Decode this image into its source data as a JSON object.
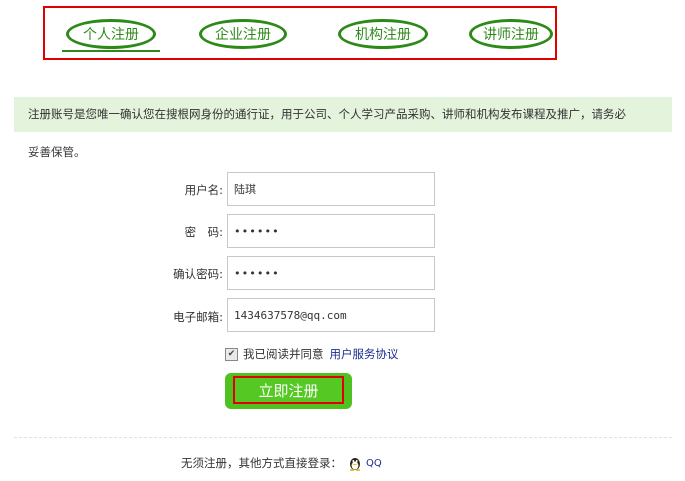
{
  "tabs": [
    {
      "label": "个人注册"
    },
    {
      "label": "企业注册"
    },
    {
      "label": "机构注册"
    },
    {
      "label": "讲师注册"
    }
  ],
  "notice": {
    "line1": "注册账号是您唯一确认您在搜根网身份的通行证，用于公司、个人学习产品采购、讲师和机构发布课程及推广，请务必",
    "line2": "妥善保管。"
  },
  "form": {
    "username_label": "用户名:",
    "username_value": "陆琪",
    "password_label": "密　码:",
    "password_value": "••••••",
    "confirm_label": "确认密码:",
    "confirm_value": "••••••",
    "email_label": "电子邮箱:",
    "email_value": "1434637578@qq.com",
    "agree_text": "我已阅读并同意",
    "agree_link": "用户服务协议",
    "agree_checked": true,
    "submit_label": "立即注册"
  },
  "alt_login": {
    "text": "无须注册，其他方式直接登录：",
    "qq_label": "QQ"
  },
  "colors": {
    "tab_green": "#2d8a19",
    "highlight_red": "#e00000",
    "notice_bg": "#e3f3dc",
    "button_green": "#4fc21f",
    "link_blue": "#1a2b8f"
  }
}
